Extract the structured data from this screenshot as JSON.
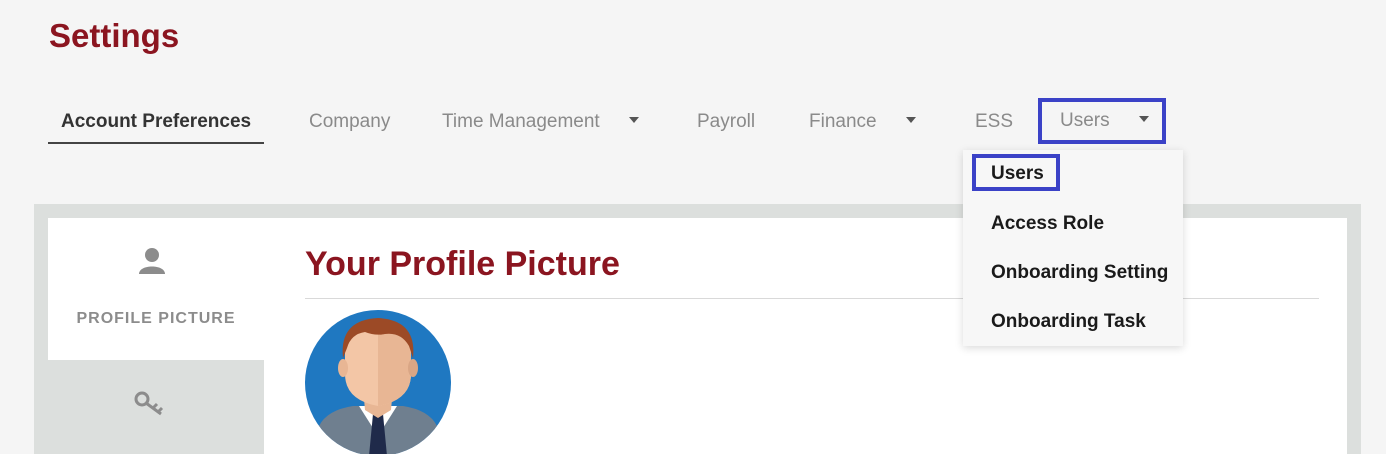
{
  "page": {
    "title": "Settings"
  },
  "tabs": [
    {
      "label": "Account Preferences",
      "active": true,
      "has_dropdown": false
    },
    {
      "label": "Company",
      "has_dropdown": false
    },
    {
      "label": "Time Management",
      "has_dropdown": true
    },
    {
      "label": "Payroll",
      "has_dropdown": false
    },
    {
      "label": "Finance",
      "has_dropdown": true
    },
    {
      "label": "ESS",
      "has_dropdown": false
    },
    {
      "label": "Users",
      "has_dropdown": true,
      "highlighted": true
    }
  ],
  "users_dropdown": {
    "items": [
      "Users",
      "Access Role",
      "Onboarding Setting",
      "Onboarding Task"
    ],
    "highlighted_item": "Users"
  },
  "side_nav": {
    "items": [
      {
        "label": "PROFILE PICTURE",
        "icon": "user-icon",
        "active": true
      },
      {
        "label": "",
        "icon": "key-icon",
        "active": false
      }
    ]
  },
  "main": {
    "section_title": "Your Profile Picture"
  },
  "colors": {
    "brand": "#8b1520",
    "highlight": "#3b42c7",
    "panel": "#dcdfdd"
  }
}
